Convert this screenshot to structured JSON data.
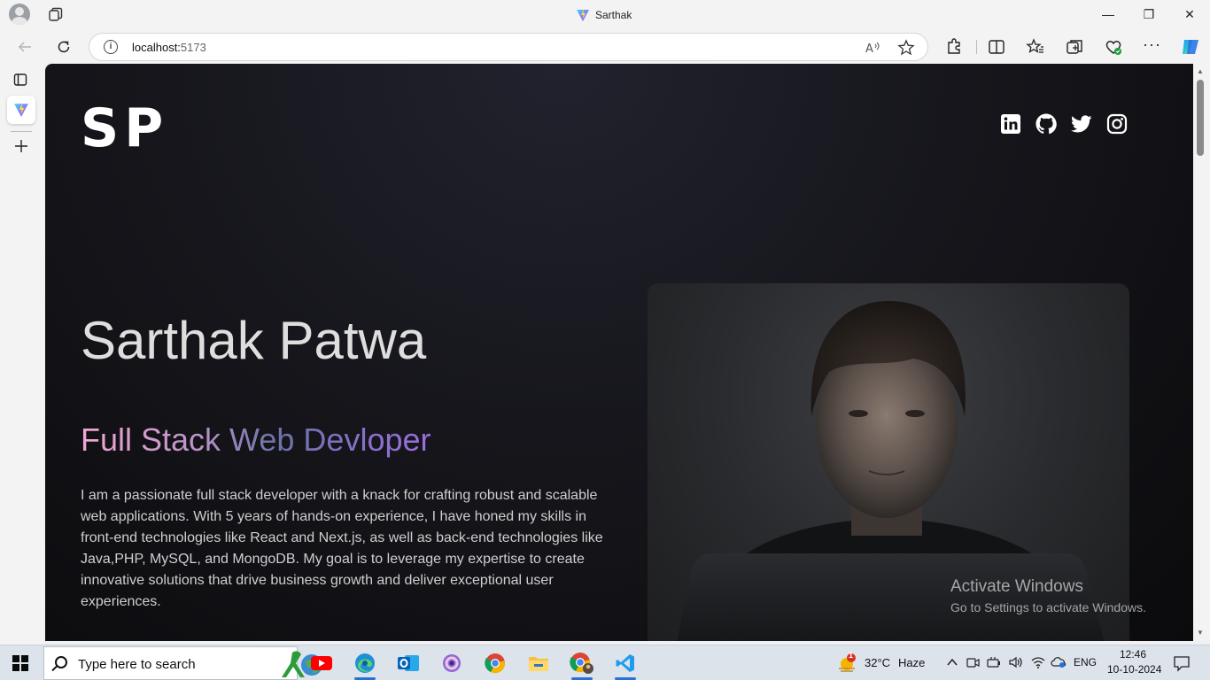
{
  "browser": {
    "tab_title": "Sarthak",
    "url_host": "localhost:",
    "url_port": "5173",
    "window_controls": {
      "minimize": "—",
      "restore": "❐",
      "close": "✕"
    }
  },
  "page": {
    "logo": "SP",
    "name": "Sarthak Patwa",
    "role": "Full Stack Web Devloper",
    "bio": "I am a passionate full stack developer with a knack for crafting robust and scalable web applications. With 5 years of hands-on experience, I have honed my skills in front-end technologies like React and Next.js, as well as back-end technologies like Java,PHP, MySQL, and MongoDB. My goal is to leverage my expertise to create innovative solutions that drive business growth and deliver exceptional user experiences.",
    "socials": [
      "linkedin-icon",
      "github-icon",
      "twitter-icon",
      "instagram-icon"
    ]
  },
  "watermark": {
    "line1": "Activate Windows",
    "line2": "Go to Settings to activate Windows."
  },
  "taskbar": {
    "search_placeholder": "Type here to search",
    "weather_temp": "32°C",
    "weather_desc": "Haze",
    "weather_badge": "1",
    "language": "ENG",
    "time": "12:46",
    "date": "10-10-2024"
  }
}
